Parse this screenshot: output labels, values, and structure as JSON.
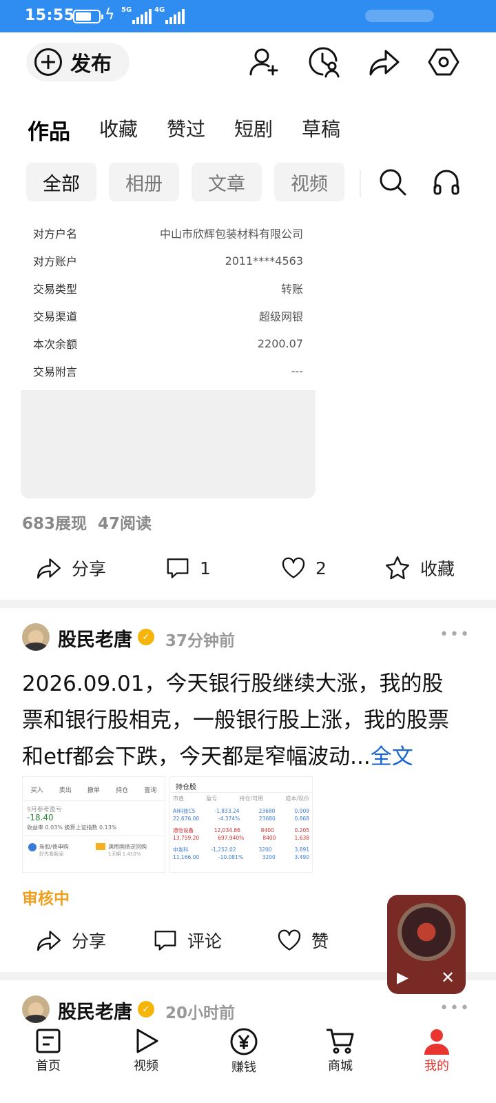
{
  "status": {
    "time": "15:55",
    "net1": "5G",
    "net2": "4G"
  },
  "header": {
    "publish_label": "发布"
  },
  "tabs": [
    {
      "label": "作品",
      "active": true
    },
    {
      "label": "收藏"
    },
    {
      "label": "赞过"
    },
    {
      "label": "短剧"
    },
    {
      "label": "草稿"
    }
  ],
  "filters": [
    {
      "label": "全部",
      "active": true
    },
    {
      "label": "相册"
    },
    {
      "label": "文章"
    },
    {
      "label": "视频"
    }
  ],
  "transaction": [
    {
      "key": "对方户名",
      "value": "中山市欣辉包装材料有限公司"
    },
    {
      "key": "对方账户",
      "value": "2011****4563"
    },
    {
      "key": "交易类型",
      "value": "转账"
    },
    {
      "key": "交易渠道",
      "value": "超级网银"
    },
    {
      "key": "本次余额",
      "value": "2200.07"
    },
    {
      "key": "交易附言",
      "value": "---"
    }
  ],
  "post1": {
    "views": "683展现",
    "reads": "47阅读",
    "share": "分享",
    "comments": "1",
    "likes": "2",
    "favorite": "收藏"
  },
  "post2": {
    "author": "股民老唐",
    "time": "37分钟前",
    "text": "2026.09.01，今天银行股继续大涨，我的股票和银行股相克，一般银行股上涨，我的股票和etf都会下跌，今天都是窄幅波动...",
    "full_link": "全文",
    "status": "审核中",
    "share": "分享",
    "comment": "评论",
    "like": "赞",
    "thumb1": {
      "tabs": [
        "买入",
        "卖出",
        "撤单",
        "持仓",
        "查询"
      ],
      "profit_label": "9月参考盈亏",
      "profit_value": "-18.40",
      "rate_line": "收益率 0.03%  换算上证指数 0.13%",
      "ipo": "新股/债申购",
      "ipo_sub": "好先看新闻",
      "repo": "满用国债逆回购",
      "repo_sub": "1天期 1.410%"
    },
    "thumb2": {
      "title": "持仓股",
      "headers": [
        "市值",
        "盈亏",
        "持仓/可用",
        "成本/现价"
      ],
      "rows": [
        [
          "AI科技C5",
          "-1,833.24",
          "23680",
          "0.909"
        ],
        [
          "22,676.00",
          "-4.374%",
          "23680",
          "0.868"
        ],
        [
          "通信设备",
          "12,034.86",
          "8400",
          "0.205"
        ],
        [
          "13,759.20",
          "697.940%",
          "8400",
          "1.638"
        ],
        [
          "中发科",
          "-1,252.02",
          "3200",
          "3.891"
        ],
        [
          "11,166.00",
          "-10.081%",
          "3200",
          "3.490"
        ]
      ]
    }
  },
  "post3": {
    "author": "股民老唐",
    "time": "20小时前"
  },
  "bottom_nav": [
    {
      "label": "首页"
    },
    {
      "label": "视频"
    },
    {
      "label": "赚钱"
    },
    {
      "label": "商城"
    },
    {
      "label": "我的",
      "active": true
    }
  ],
  "colors": {
    "accent_blue": "#2f8cf0",
    "link_blue": "#1a66d0",
    "nav_active": "#e8352f",
    "review_orange": "#f0a020"
  }
}
